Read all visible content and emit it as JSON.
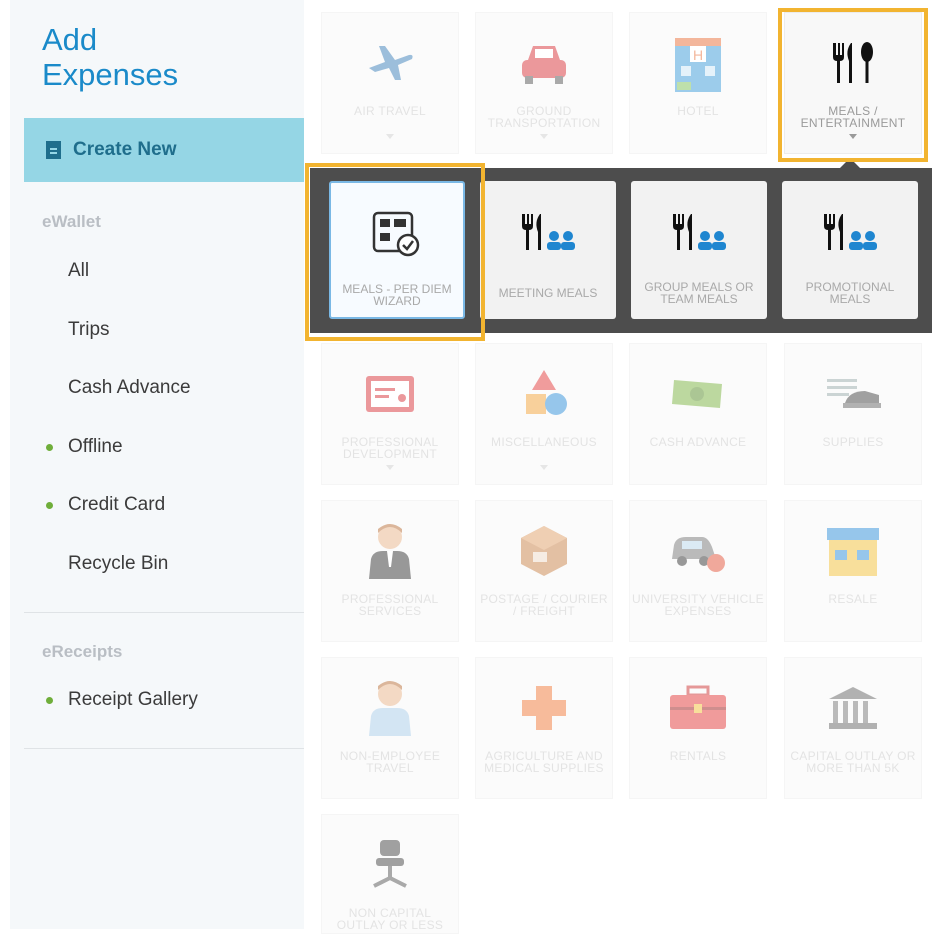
{
  "sidebar": {
    "title": "Add\nExpenses",
    "create_new": "Create New",
    "ewallet_heading": "eWallet",
    "ewallet_items": [
      "All",
      "Trips",
      "Cash Advance",
      "Offline",
      "Credit Card",
      "Recycle Bin"
    ],
    "ereceipts_heading": "eReceipts",
    "ereceipts_items": [
      "Receipt Gallery"
    ],
    "status_dot_color": "#6fae3a"
  },
  "categories": [
    {
      "label": "AIR TRAVEL",
      "icon": "airplane-icon"
    },
    {
      "label": "GROUND TRANSPORTATION",
      "icon": "car-icon"
    },
    {
      "label": "HOTEL",
      "icon": "hotel-icon"
    },
    {
      "label": "MEALS / ENTERTAINMENT",
      "icon": "cutlery-icon"
    },
    {
      "label": "PROFESSIONAL DEVELOPMENT",
      "icon": "certificate-icon"
    },
    {
      "label": "MISCELLANEOUS",
      "icon": "shapes-icon"
    },
    {
      "label": "CASH ADVANCE",
      "icon": "cash-icon"
    },
    {
      "label": "SUPPLIES",
      "icon": "stapler-icon"
    },
    {
      "label": "PROFESSIONAL SERVICES",
      "icon": "businessman-icon"
    },
    {
      "label": "POSTAGE / COURIER / FREIGHT",
      "icon": "package-icon"
    },
    {
      "label": "UNIVERSITY VEHICLE EXPENSES",
      "icon": "vehicle-icon"
    },
    {
      "label": "RESALE",
      "icon": "store-icon"
    },
    {
      "label": "NON-EMPLOYEE TRAVEL",
      "icon": "person-icon"
    },
    {
      "label": "AGRICULTURE AND MEDICAL SUPPLIES",
      "icon": "medical-cross-icon"
    },
    {
      "label": "RENTALS",
      "icon": "toolbox-icon"
    },
    {
      "label": "CAPITAL OUTLAY OR MORE THAN 5K",
      "icon": "bank-icon"
    },
    {
      "label": "NON CAPITAL OUTLAY OR LESS",
      "icon": "office-chair-icon"
    }
  ],
  "meals_submenu": [
    {
      "label": "MEALS - PER DIEM WIZARD",
      "icon": "per-diem-wizard-icon"
    },
    {
      "label": "MEETING MEALS",
      "icon": "meeting-meals-icon"
    },
    {
      "label": "GROUP MEALS OR TEAM MEALS",
      "icon": "group-meals-icon"
    },
    {
      "label": "PROMOTIONAL MEALS",
      "icon": "promotional-meals-icon"
    }
  ],
  "colors": {
    "accent": "#1a8ac9",
    "create_new_bg": "#95d6e5",
    "highlight": "#f2b430",
    "submenu_bg": "#4d4d4d"
  }
}
